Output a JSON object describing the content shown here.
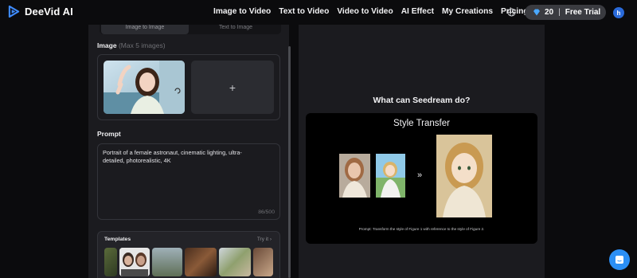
{
  "app": {
    "name": "DeeVid AI"
  },
  "nav": {
    "items": [
      "Image to Video",
      "Text to Video",
      "Video to Video",
      "AI Effect",
      "My Creations",
      "Pricing"
    ]
  },
  "header": {
    "credits": "20",
    "free_trial": "Free Trial",
    "avatar_initial": "h"
  },
  "left_panel": {
    "mode_tabs": [
      "Image to Image",
      "Text to Image"
    ],
    "image_label": "Image",
    "image_hint": "(Max 5 images)",
    "add_slot": "+",
    "prompt_label": "Prompt",
    "prompt_value": "Portrait of a female astronaut, cinematic lighting, ultra-detailed, photorealistic, 4K",
    "prompt_counter": "86/500",
    "templates_label": "Templates",
    "try_it": "Try it"
  },
  "right_panel": {
    "heading": "What can Seedream do?",
    "demo_title": "Style Transfer",
    "arrow": "»",
    "caption": "Prompt: Transform the style of Figure 1 with reference to the style of Figure 2."
  },
  "colors": {
    "background": "#0b0b0d",
    "panel": "#1b1b1f",
    "accent": "#2b8ff5",
    "credits_pill": "#3a3b40"
  }
}
